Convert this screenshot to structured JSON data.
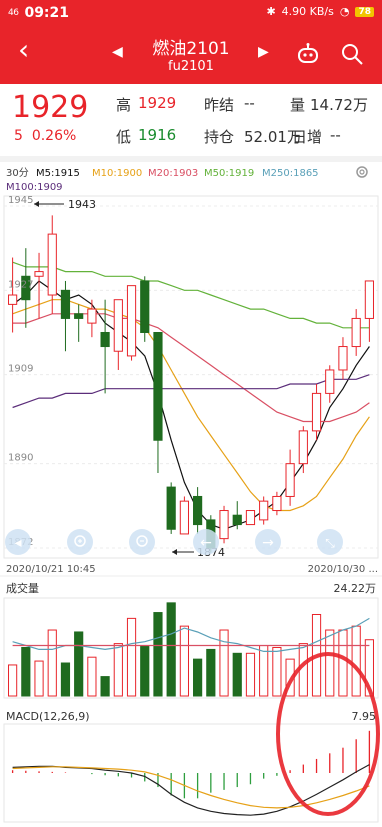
{
  "status_bar": {
    "signal": "46",
    "time": "09:21",
    "net_speed": "4.90 KB/s",
    "battery": "78"
  },
  "header": {
    "name": "燃油2101",
    "code": "fu2101"
  },
  "quote": {
    "price": "1929",
    "change": "5",
    "change_pct": "0.26%",
    "high_label": "高",
    "high": "1929",
    "low_label": "低",
    "low": "1916",
    "prev_settle_label": "昨结",
    "prev_settle": "--",
    "volume_label": "量",
    "volume": "14.72万",
    "open_interest_label": "持仓",
    "open_interest": "52.01万",
    "daily_change_label": "日增",
    "daily_change": "--"
  },
  "colors": {
    "up": "#e8242a",
    "down": "#1f6b1f",
    "ma5": "#111111",
    "ma10": "#e6a117",
    "ma20": "#d94f63",
    "ma50": "#63b23a",
    "ma250": "#5aa0b8",
    "ma100": "#5b2d7a"
  },
  "chart_data": [
    {
      "type": "candlestick",
      "period": "30分",
      "legend": [
        {
          "name": "M5",
          "value": "1915"
        },
        {
          "name": "M10",
          "value": "1900"
        },
        {
          "name": "M20",
          "value": "1903"
        },
        {
          "name": "M50",
          "value": "1919"
        },
        {
          "name": "M250",
          "value": "1865"
        },
        {
          "name": "M100",
          "value": "1909"
        }
      ],
      "y_ticks": [
        "1945",
        "1927",
        "1909",
        "1890",
        "1872"
      ],
      "ylim": [
        1872,
        1945
      ],
      "max_marker": "1943",
      "min_marker": "1874",
      "x_start_label": "2020/10/21 10:45",
      "x_end_label": "2020/10/30 ...",
      "candles": [
        {
          "o": 1924,
          "h": 1934,
          "l": 1918,
          "c": 1926
        },
        {
          "o": 1930,
          "h": 1936,
          "l": 1919,
          "c": 1925
        },
        {
          "o": 1930,
          "h": 1935,
          "l": 1921,
          "c": 1931
        },
        {
          "o": 1926,
          "h": 1943,
          "l": 1922,
          "c": 1939
        },
        {
          "o": 1927,
          "h": 1929,
          "l": 1914,
          "c": 1921
        },
        {
          "o": 1922,
          "h": 1924,
          "l": 1916,
          "c": 1921
        },
        {
          "o": 1920,
          "h": 1925,
          "l": 1917,
          "c": 1923
        },
        {
          "o": 1918,
          "h": 1925,
          "l": 1905,
          "c": 1915
        },
        {
          "o": 1914,
          "h": 1918,
          "l": 1910,
          "c": 1925
        },
        {
          "o": 1913,
          "h": 1928,
          "l": 1912,
          "c": 1928
        },
        {
          "o": 1929,
          "h": 1930,
          "l": 1916,
          "c": 1918
        },
        {
          "o": 1918,
          "h": 1918,
          "l": 1888,
          "c": 1895
        },
        {
          "o": 1885,
          "h": 1886,
          "l": 1875,
          "c": 1876
        },
        {
          "o": 1875,
          "h": 1883,
          "l": 1875,
          "c": 1882
        },
        {
          "o": 1883,
          "h": 1885,
          "l": 1875,
          "c": 1877
        },
        {
          "o": 1878,
          "h": 1879,
          "l": 1871,
          "c": 1872
        },
        {
          "o": 1874,
          "h": 1881,
          "l": 1873,
          "c": 1880
        },
        {
          "o": 1879,
          "h": 1882,
          "l": 1876,
          "c": 1877
        },
        {
          "o": 1877,
          "h": 1880,
          "l": 1877,
          "c": 1880
        },
        {
          "o": 1878,
          "h": 1883,
          "l": 1877,
          "c": 1882
        },
        {
          "o": 1880,
          "h": 1884,
          "l": 1879,
          "c": 1883
        },
        {
          "o": 1883,
          "h": 1893,
          "l": 1881,
          "c": 1890
        },
        {
          "o": 1890,
          "h": 1898,
          "l": 1888,
          "c": 1897
        },
        {
          "o": 1897,
          "h": 1907,
          "l": 1895,
          "c": 1905
        },
        {
          "o": 1905,
          "h": 1911,
          "l": 1903,
          "c": 1910
        },
        {
          "o": 1910,
          "h": 1917,
          "l": 1908,
          "c": 1915
        },
        {
          "o": 1915,
          "h": 1923,
          "l": 1913,
          "c": 1921
        },
        {
          "o": 1921,
          "h": 1929,
          "l": 1916,
          "c": 1929
        }
      ],
      "ma_lines": {
        "ma5": [
          1924,
          1926,
          1929,
          1927,
          1925,
          1926,
          1924,
          1920,
          1918,
          1916,
          1913,
          1905,
          1895,
          1886,
          1880,
          1877,
          1876,
          1877,
          1878,
          1880,
          1882,
          1886,
          1890,
          1895,
          1902,
          1906,
          1911,
          1915
        ],
        "ma10": [
          1922,
          1923,
          1924,
          1925,
          1925,
          1924,
          1923,
          1923,
          1922,
          1921,
          1919,
          1915,
          1910,
          1905,
          1900,
          1896,
          1892,
          1888,
          1884,
          1881,
          1880,
          1880,
          1881,
          1883,
          1887,
          1891,
          1896,
          1900
        ],
        "ma20": [
          1920,
          1920,
          1921,
          1922,
          1922,
          1922,
          1922,
          1922,
          1921,
          1921,
          1920,
          1919,
          1917,
          1915,
          1913,
          1911,
          1909,
          1907,
          1905,
          1903,
          1901,
          1900,
          1899,
          1899,
          1899,
          1900,
          1901,
          1903
        ],
        "ma50": [
          1933,
          1932,
          1932,
          1932,
          1931,
          1931,
          1931,
          1930,
          1930,
          1930,
          1929,
          1929,
          1928,
          1927,
          1927,
          1926,
          1925,
          1924,
          1923,
          1923,
          1922,
          1921,
          1921,
          1920,
          1920,
          1919,
          1919,
          1919
        ],
        "ma100": [
          1902,
          1903,
          1904,
          1904,
          1905,
          1905,
          1905,
          1906,
          1906,
          1906,
          1906,
          1906,
          1906,
          1906,
          1906,
          1906,
          1906,
          1906,
          1906,
          1906,
          1906,
          1907,
          1907,
          1907,
          1908,
          1908,
          1908,
          1909
        ]
      }
    },
    {
      "type": "bar",
      "title": "成交量",
      "max_label": "24.22万",
      "values": [
        8.0,
        12.5,
        9.0,
        17.0,
        8.5,
        16.5,
        10.0,
        5.0,
        13.5,
        20.0,
        13.0,
        21.5,
        24.0,
        18.0,
        9.5,
        12.0,
        17.0,
        11.0,
        11.0,
        13.0,
        12.5,
        9.5,
        13.5,
        21.0,
        17.0,
        17.0,
        18.0,
        14.5
      ],
      "ma_lines": {
        "ma5": [
          14.0,
          13.0,
          12.0,
          12.0,
          13.0,
          13.0,
          12.5,
          12.0,
          12.5,
          13.5,
          14.0,
          15.0,
          16.0,
          17.5,
          16.5,
          15.0,
          14.0,
          13.5,
          12.5,
          11.5,
          11.5,
          12.0,
          12.5,
          14.0,
          15.5,
          17.0,
          18.0,
          20.0
        ],
        "ma10": [
          13.0,
          13.0,
          13.0,
          13.0,
          13.0,
          13.0,
          13.0,
          13.0,
          13.0,
          13.0,
          13.0,
          13.0,
          13.0,
          13.0,
          13.0,
          13.0,
          13.0,
          13.0,
          13.0,
          13.0,
          13.0,
          13.0,
          13.0,
          13.0,
          13.0,
          13.0,
          13.0,
          13.0
        ]
      }
    },
    {
      "type": "bar",
      "title": "MACD(12,26,9)",
      "max_label": "7.95",
      "macd": [
        0.5,
        0.4,
        0.3,
        0.2,
        0.1,
        0.0,
        -0.2,
        -0.4,
        -0.6,
        -0.8,
        -1.5,
        -2.5,
        -4.0,
        -4.5,
        -4.5,
        -3.5,
        -3.0,
        -2.5,
        -2.0,
        -1.0,
        -0.5,
        0.5,
        1.5,
        2.5,
        3.5,
        4.5,
        6.0,
        7.5
      ],
      "dif": [
        1.0,
        1.1,
        1.2,
        1.2,
        1.0,
        0.9,
        0.8,
        0.5,
        0.3,
        0.0,
        -0.6,
        -2.0,
        -3.8,
        -5.2,
        -6.2,
        -6.8,
        -7.2,
        -7.4,
        -7.5,
        -7.3,
        -6.8,
        -6.0,
        -5.0,
        -3.8,
        -2.5,
        -1.2,
        0.2,
        1.5
      ],
      "dea": [
        0.8,
        0.9,
        1.0,
        1.1,
        1.1,
        1.0,
        0.9,
        0.8,
        0.7,
        0.5,
        0.2,
        -0.4,
        -1.2,
        -2.2,
        -3.2,
        -4.0,
        -4.7,
        -5.3,
        -5.8,
        -6.1,
        -6.2,
        -6.1,
        -5.8,
        -5.3,
        -4.7,
        -4.0,
        -3.2,
        -2.3
      ],
      "ylim": [
        -8,
        8
      ]
    }
  ]
}
